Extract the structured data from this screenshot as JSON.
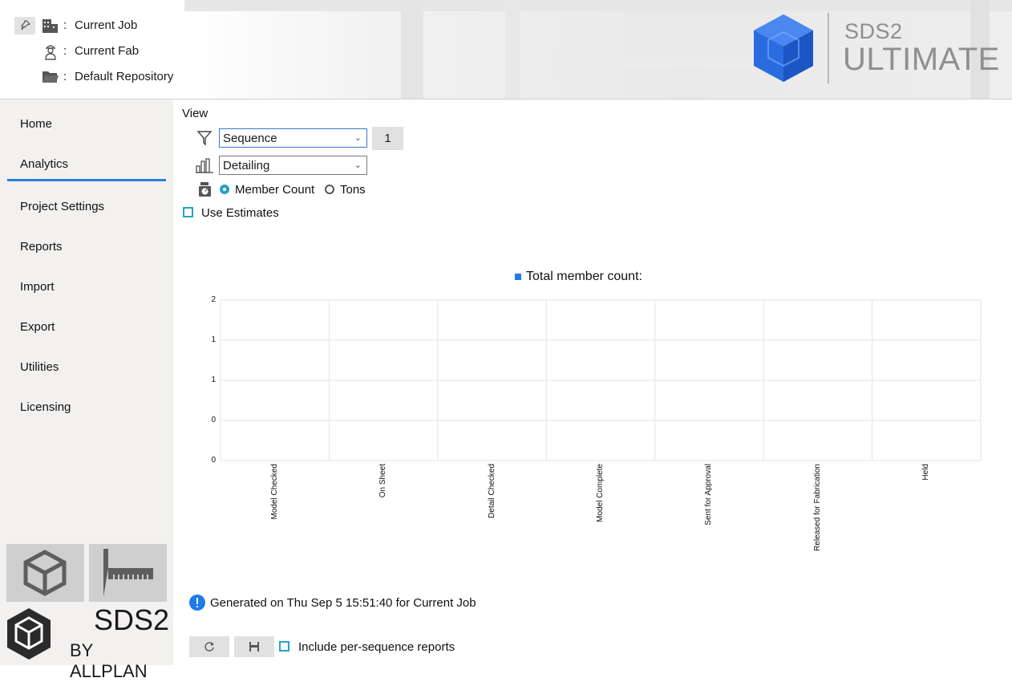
{
  "header": {
    "job_label": "Current Job",
    "fab_label": "Current Fab",
    "repository_label": "Default Repository",
    "separator": ":",
    "logo_line1": "SDS2",
    "logo_line2": "ULTIMATE",
    "accent_color": "#2a6be0"
  },
  "sidebar": {
    "items": [
      {
        "label": "Home"
      },
      {
        "label": "Analytics",
        "active": true
      },
      {
        "label": "Project Settings"
      },
      {
        "label": "Reports"
      },
      {
        "label": "Import"
      },
      {
        "label": "Export"
      },
      {
        "label": "Utilities"
      },
      {
        "label": "Licensing"
      }
    ],
    "brand_line1": "SDS2",
    "brand_line2": "BY ALLPLAN"
  },
  "view": {
    "title": "View",
    "filter_select": "Sequence",
    "filter_count": "1",
    "category_select": "Detailing",
    "radio_member_count": "Member Count",
    "radio_tons": "Tons",
    "radio_selected": "Member Count",
    "use_estimates_label": "Use Estimates",
    "use_estimates_checked": false
  },
  "chart_data": {
    "type": "bar",
    "legend": "Total member count:",
    "categories": [
      "Model Checked",
      "On Sheet",
      "Detail Checked",
      "Model Complete",
      "Sent for Approval",
      "Released for Fabrication",
      "Held"
    ],
    "series": [
      {
        "name": "Total member count:",
        "values": [
          0,
          0,
          0,
          0,
          0,
          0,
          0
        ],
        "color": "#1e7be8"
      }
    ],
    "yticks": [
      "2",
      "1",
      "1",
      "0",
      "0"
    ],
    "ylim": [
      0,
      2
    ],
    "grid": true
  },
  "footer": {
    "generated_text": "Generated on Thu Sep 5 15:51:40 for Current Job",
    "include_label": "Include per-sequence reports",
    "include_checked": false
  }
}
